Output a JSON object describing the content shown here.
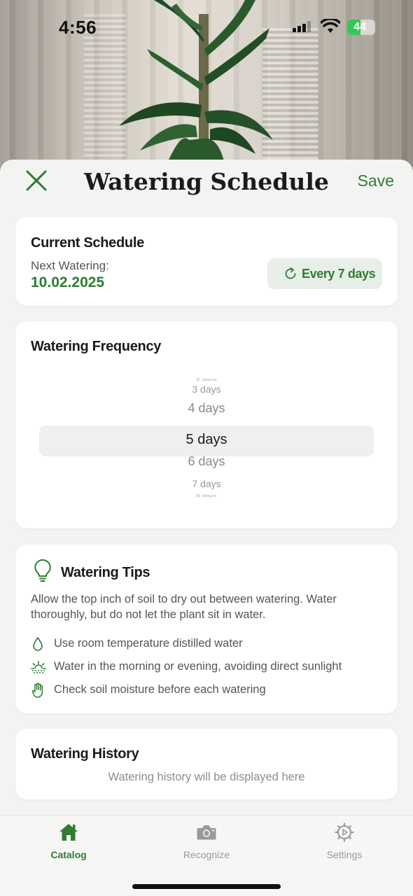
{
  "status_bar": {
    "time": "4:56",
    "battery": "44"
  },
  "header": {
    "title": "Watering Schedule",
    "save_label": "Save"
  },
  "current_schedule": {
    "title": "Current Schedule",
    "next_label": "Next Watering:",
    "next_date": "10.02.2025",
    "frequency_label": "Every 7 days"
  },
  "frequency": {
    "title": "Watering Frequency",
    "options": [
      "2 days",
      "3 days",
      "4 days",
      "5 days",
      "6 days",
      "7 days",
      "8 days"
    ],
    "selected": "5 days"
  },
  "tips": {
    "title": "Watering Tips",
    "description": "Allow the top inch of soil to dry out between watering. Water thoroughly, but do not let the plant sit in water.",
    "items": [
      {
        "icon": "water-drop-icon",
        "text": "Use room temperature distilled water"
      },
      {
        "icon": "sunrise-icon",
        "text": "Water in the morning or evening, avoiding direct sunlight"
      },
      {
        "icon": "hand-icon",
        "text": "Check soil moisture before each watering"
      }
    ]
  },
  "history": {
    "title": "Watering History",
    "empty_text": "Watering history will be displayed here"
  },
  "tabbar": {
    "tabs": [
      {
        "label": "Catalog",
        "icon": "home-icon",
        "active": true
      },
      {
        "label": "Recognize",
        "icon": "camera-icon",
        "active": false
      },
      {
        "label": "Settings",
        "icon": "gear-icon",
        "active": false
      }
    ]
  },
  "colors": {
    "accent": "#2e7d32",
    "chip_bg": "#e8efe8",
    "background": "#f3f4f2"
  }
}
